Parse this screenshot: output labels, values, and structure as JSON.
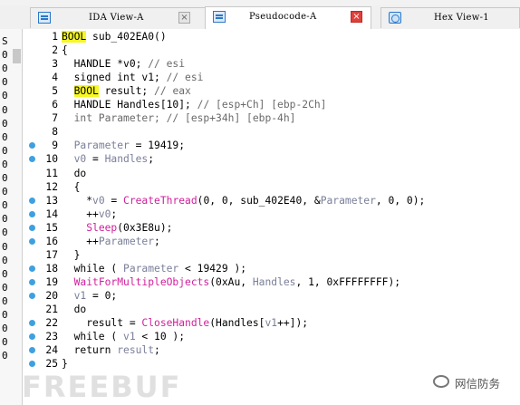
{
  "tabs": [
    {
      "label": "IDA View-A",
      "icon": "code-view-icon",
      "active": false
    },
    {
      "label": "Pseudocode-A",
      "icon": "code-view-icon",
      "active": true
    },
    {
      "label": "Hex View-1",
      "icon": "hex-view-icon",
      "active": false
    }
  ],
  "close_glyph": "×",
  "left_strip": [
    "S",
    "0",
    "0",
    "0",
    "0",
    "0",
    "0",
    "0",
    "0",
    "0",
    "0",
    "0",
    "0",
    "0",
    "0",
    "0",
    "0",
    "0",
    "0",
    "0",
    "0",
    "0",
    "0",
    "0"
  ],
  "code": {
    "lines": [
      {
        "n": "1",
        "dot": false,
        "segs": [
          {
            "t": "BOOL",
            "c": "kw-hl"
          },
          {
            "t": " sub_402EA0()",
            "c": ""
          }
        ]
      },
      {
        "n": "2",
        "dot": false,
        "segs": [
          {
            "t": "{",
            "c": ""
          }
        ]
      },
      {
        "n": "3",
        "dot": false,
        "segs": [
          {
            "t": "  HANDLE *v0; ",
            "c": ""
          },
          {
            "t": "// esi",
            "c": "cmt"
          }
        ]
      },
      {
        "n": "4",
        "dot": false,
        "segs": [
          {
            "t": "  signed int v1; ",
            "c": ""
          },
          {
            "t": "// esi",
            "c": "cmt"
          }
        ]
      },
      {
        "n": "5",
        "dot": false,
        "segs": [
          {
            "t": "  ",
            "c": ""
          },
          {
            "t": "BOOL",
            "c": "kw-hl"
          },
          {
            "t": " result; ",
            "c": ""
          },
          {
            "t": "// eax",
            "c": "cmt"
          }
        ]
      },
      {
        "n": "6",
        "dot": false,
        "segs": [
          {
            "t": "  HANDLE Handles[10]; ",
            "c": ""
          },
          {
            "t": "// [esp+Ch] [ebp-2Ch]",
            "c": "cmt"
          }
        ]
      },
      {
        "n": "7",
        "dot": false,
        "segs": [
          {
            "t": "  int Parameter; ",
            "c": "cmt"
          },
          {
            "t": "// [esp+34h] [ebp-4h]",
            "c": "cmt"
          }
        ]
      },
      {
        "n": "8",
        "dot": false,
        "segs": [
          {
            "t": "",
            "c": ""
          }
        ]
      },
      {
        "n": "9",
        "dot": true,
        "segs": [
          {
            "t": "  ",
            "c": ""
          },
          {
            "t": "Parameter",
            "c": "var"
          },
          {
            "t": " = 19419;",
            "c": ""
          }
        ]
      },
      {
        "n": "10",
        "dot": true,
        "segs": [
          {
            "t": "  ",
            "c": ""
          },
          {
            "t": "v0",
            "c": "var"
          },
          {
            "t": " = ",
            "c": ""
          },
          {
            "t": "Handles",
            "c": "var"
          },
          {
            "t": ";",
            "c": ""
          }
        ]
      },
      {
        "n": "11",
        "dot": false,
        "segs": [
          {
            "t": "  do",
            "c": ""
          }
        ]
      },
      {
        "n": "12",
        "dot": false,
        "segs": [
          {
            "t": "  {",
            "c": ""
          }
        ]
      },
      {
        "n": "13",
        "dot": true,
        "segs": [
          {
            "t": "    *",
            "c": ""
          },
          {
            "t": "v0",
            "c": "var"
          },
          {
            "t": " = ",
            "c": ""
          },
          {
            "t": "CreateThread",
            "c": "fn"
          },
          {
            "t": "(0, 0, sub_402E40, &",
            "c": ""
          },
          {
            "t": "Parameter",
            "c": "var"
          },
          {
            "t": ", 0, 0);",
            "c": ""
          }
        ]
      },
      {
        "n": "14",
        "dot": true,
        "segs": [
          {
            "t": "    ++",
            "c": ""
          },
          {
            "t": "v0",
            "c": "var"
          },
          {
            "t": ";",
            "c": ""
          }
        ]
      },
      {
        "n": "15",
        "dot": true,
        "segs": [
          {
            "t": "    ",
            "c": ""
          },
          {
            "t": "Sleep",
            "c": "fn"
          },
          {
            "t": "(0x3E8u);",
            "c": ""
          }
        ]
      },
      {
        "n": "16",
        "dot": true,
        "segs": [
          {
            "t": "    ++",
            "c": ""
          },
          {
            "t": "Parameter",
            "c": "var"
          },
          {
            "t": ";",
            "c": ""
          }
        ]
      },
      {
        "n": "17",
        "dot": false,
        "segs": [
          {
            "t": "  }",
            "c": ""
          }
        ]
      },
      {
        "n": "18",
        "dot": true,
        "segs": [
          {
            "t": "  while ( ",
            "c": ""
          },
          {
            "t": "Parameter",
            "c": "var"
          },
          {
            "t": " < 19429 );",
            "c": ""
          }
        ]
      },
      {
        "n": "19",
        "dot": true,
        "segs": [
          {
            "t": "  ",
            "c": ""
          },
          {
            "t": "WaitForMultipleObjects",
            "c": "fn"
          },
          {
            "t": "(0xAu, ",
            "c": ""
          },
          {
            "t": "Handles",
            "c": "var"
          },
          {
            "t": ", 1, 0xFFFFFFFF);",
            "c": ""
          }
        ]
      },
      {
        "n": "20",
        "dot": true,
        "segs": [
          {
            "t": "  ",
            "c": ""
          },
          {
            "t": "v1",
            "c": "var"
          },
          {
            "t": " = 0;",
            "c": ""
          }
        ]
      },
      {
        "n": "21",
        "dot": false,
        "segs": [
          {
            "t": "  do",
            "c": ""
          }
        ]
      },
      {
        "n": "22",
        "dot": true,
        "segs": [
          {
            "t": "    result = ",
            "c": ""
          },
          {
            "t": "CloseHandle",
            "c": "fn"
          },
          {
            "t": "(Handles[",
            "c": ""
          },
          {
            "t": "v1",
            "c": "var"
          },
          {
            "t": "++]);",
            "c": ""
          }
        ]
      },
      {
        "n": "23",
        "dot": true,
        "segs": [
          {
            "t": "  while ( ",
            "c": ""
          },
          {
            "t": "v1",
            "c": "var"
          },
          {
            "t": " < 10 );",
            "c": ""
          }
        ]
      },
      {
        "n": "24",
        "dot": true,
        "segs": [
          {
            "t": "  return ",
            "c": ""
          },
          {
            "t": "result",
            "c": "var"
          },
          {
            "t": ";",
            "c": ""
          }
        ]
      },
      {
        "n": "25",
        "dot": true,
        "segs": [
          {
            "t": "}",
            "c": ""
          }
        ]
      }
    ]
  },
  "watermark": {
    "left": "FREEBUF",
    "right": "网信防务",
    "right_icon": "wechat-icon"
  },
  "colors": {
    "keyword_highlight": "#f7f725",
    "breakpoint_dot": "#3fa0e0",
    "function": "#d0209c",
    "variable": "#7a7f99",
    "comment": "#6a6a6a"
  }
}
